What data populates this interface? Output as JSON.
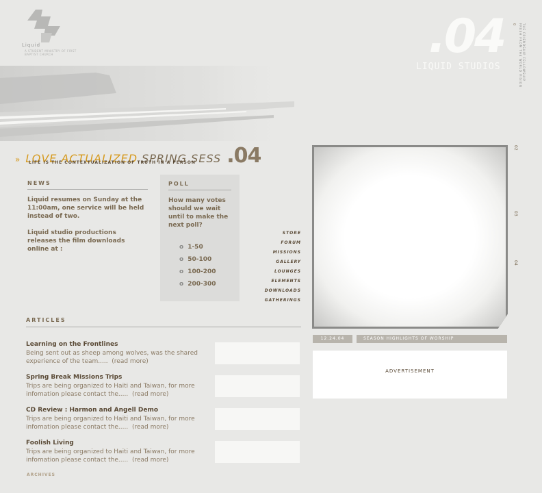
{
  "header": {
    "logo_text": "Liquid",
    "logo_subtitle": "a student ministry of first baptist church",
    "issue_number": ".04",
    "studio_name": "LIQUID STUDIOS",
    "vertical_index": "0",
    "vertical_tagline": "the friendship fellowship fresh from the world vision"
  },
  "feature": {
    "arrow": "»",
    "title_highlight": "LOVE ACTUALIZED",
    "title_rest": "SPRING SESS",
    "title_number": ".04",
    "subtitle": "life is the contextualization of truth in a person"
  },
  "news": {
    "heading": "NEWS",
    "items": [
      "Liquid resumes on Sunday at the 11:00am, one service will be held instead of two.",
      "Liquid studio productions releases the film downloads online at :"
    ]
  },
  "poll": {
    "heading": "POLL",
    "question": "How many votes should we wait until to make the next poll?",
    "options": [
      "1-50",
      "50-100",
      "100-200",
      "200-300"
    ]
  },
  "nav": {
    "items": [
      "STORE",
      "FORUM",
      "MISSIONS",
      "GALLERY",
      "LOUNGES",
      "ELEMENTS",
      "DOWNLOADS",
      "GATHERINGS"
    ]
  },
  "articles": {
    "heading": "ARTICLES",
    "read_more": "(read more)",
    "items": [
      {
        "title": "Learning on the Frontlines",
        "text": "Being sent out as sheep among wolves, was the shared experience of the team....."
      },
      {
        "title": "Spring Break Missions Trips",
        "text": "Trips are being organized to Haiti and Taiwan, for more infomation please contact the....."
      },
      {
        "title": "CD Review : Harmon and Angell Demo",
        "text": "Trips are being organized to Haiti and Taiwan, for more infomation please contact the....."
      },
      {
        "title": "Foolish Living",
        "text": "Trips are being organized to Haiti and Taiwan, for more infomation please contact the....."
      }
    ],
    "archives": "ARCHIVES"
  },
  "video": {
    "ticks": [
      "02",
      "03",
      "04"
    ],
    "date": "12.24.04",
    "caption": "SEASON HIGHLIGHTS OF WORSHIP"
  },
  "ad": {
    "label": "ADVERTISEMENT"
  },
  "colors": {
    "background": "#e8e8e6",
    "accent": "#d69a1f",
    "brown": "#7a6a52",
    "panel": "#dcdcda"
  }
}
